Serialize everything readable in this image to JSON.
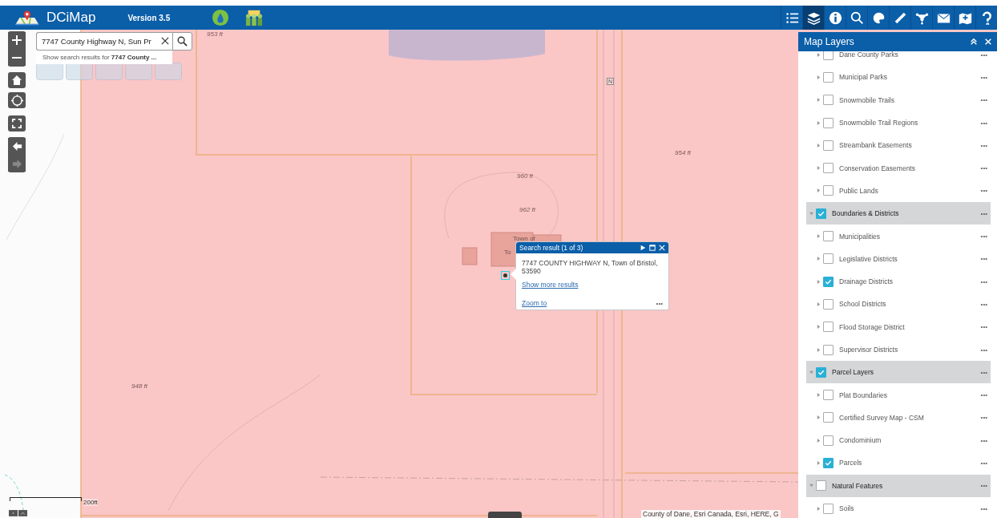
{
  "header": {
    "title": "DCiMap",
    "version": "Version 3.5",
    "tools": [
      {
        "kind": "list",
        "selected": false
      },
      {
        "kind": "layers",
        "selected": true
      },
      {
        "kind": "info",
        "selected": false
      },
      {
        "kind": "search",
        "selected": false
      },
      {
        "kind": "palette",
        "selected": false
      },
      {
        "kind": "ruler",
        "selected": false
      },
      {
        "kind": "network",
        "selected": false
      },
      {
        "kind": "mail",
        "selected": false
      },
      {
        "kind": "map-add",
        "selected": false
      },
      {
        "kind": "help",
        "selected": false
      }
    ]
  },
  "search": {
    "value": "7747 County Highway N, Sun Pr",
    "suggestion": "Show search results for **7747 County ...**"
  },
  "nav": [
    {
      "kind": "back",
      "disabled": false
    },
    {
      "kind": "forward",
      "disabled": true
    }
  ],
  "map_labels": [
    {
      "text": "953 ft",
      "kind": "elevation"
    },
    {
      "text": "954 ft",
      "kind": "elevation"
    },
    {
      "text": "960 ft",
      "kind": "elevation"
    },
    {
      "text": "962 ft",
      "kind": "elevation"
    },
    {
      "text": "948 ft",
      "kind": "elevation"
    },
    {
      "text": "N",
      "kind": "route"
    },
    {
      "text": "Town of",
      "kind": "place"
    },
    {
      "text": "To",
      "kind": "place"
    }
  ],
  "popup": {
    "title": "Search result (1 of 3)",
    "address": "7747 COUNTY HIGHWAY N, Town of Bristol, 53590",
    "more_link": "Show more results",
    "zoom_link": "Zoom to",
    "menu": "•••"
  },
  "scale": "200ft",
  "attribution": "County of Dane, Esri Canada, Esri, HERE, G",
  "panel": {
    "title": "Map Layers",
    "layers": [
      {
        "label": "Dane County Parks",
        "checked": false
      },
      {
        "label": "Municipal Parks",
        "checked": false
      },
      {
        "label": "Snowmobile Trails",
        "checked": false
      },
      {
        "label": "Snowmobile Trail Regions",
        "checked": false
      },
      {
        "label": "Streambank Easements",
        "checked": false
      },
      {
        "label": "Conservation Easements",
        "checked": false
      },
      {
        "label": "Public Lands",
        "checked": false
      },
      {
        "label": "Boundaries & Districts",
        "checked": true,
        "expanded": true,
        "children": [
          {
            "label": "Municipalities",
            "checked": false
          },
          {
            "label": "Legislative Districts",
            "checked": false
          },
          {
            "label": "Drainage Districts",
            "checked": true
          },
          {
            "label": "School Districts",
            "checked": false
          },
          {
            "label": "Flood Storage District",
            "checked": false
          },
          {
            "label": "Supervisor Districts",
            "checked": false
          }
        ]
      },
      {
        "label": "Parcel Layers",
        "checked": true,
        "expanded": true,
        "children": [
          {
            "label": "Plat Boundaries",
            "checked": false
          },
          {
            "label": "Certified Survey Map - CSM",
            "checked": false
          },
          {
            "label": "Condominium",
            "checked": false
          },
          {
            "label": "Parcels",
            "checked": true
          }
        ]
      },
      {
        "label": "Natural Features",
        "checked": false,
        "expanded": true,
        "children": [
          {
            "label": "Soils",
            "checked": false
          }
        ]
      }
    ],
    "row_menu": "•••"
  }
}
